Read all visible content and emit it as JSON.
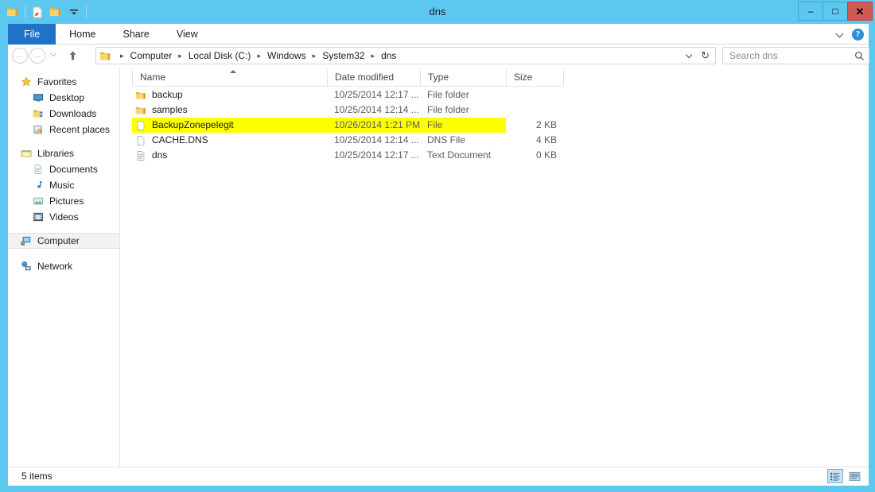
{
  "window": {
    "title": "dns",
    "controls": {
      "minimize": "–",
      "maximize": "□",
      "close": "✕"
    },
    "colors": {
      "frame": "#5cc8ef",
      "file_tab": "#1e72c8",
      "close_button": "#cf5a51",
      "highlight": "#ffff00",
      "selection": "#f2f2f2"
    }
  },
  "quick_access": [
    {
      "name": "folder-icon",
      "label": "Folder"
    },
    {
      "name": "properties-icon",
      "label": "Properties"
    },
    {
      "name": "new-folder-icon",
      "label": "New folder"
    },
    {
      "name": "customize-dropdown-icon",
      "label": "Customize Quick Access Toolbar"
    }
  ],
  "ribbon": {
    "tabs": [
      {
        "label": "File",
        "active": true
      },
      {
        "label": "Home",
        "active": false
      },
      {
        "label": "Share",
        "active": false
      },
      {
        "label": "View",
        "active": false
      }
    ],
    "expand_icon": "chevron-down-icon",
    "help_label": "?"
  },
  "address_bar": {
    "back_glyph": "←",
    "forward_glyph": "→",
    "recent_icon": "chevron-down-icon",
    "up_glyph": "↑",
    "breadcrumbs": [
      "Computer",
      "Local Disk (C:)",
      "Windows",
      "System32",
      "dns"
    ],
    "separator": "▸",
    "refresh_glyph": "↻"
  },
  "search": {
    "placeholder": "Search dns",
    "value": "",
    "icon": "search-icon"
  },
  "sidebar": {
    "groups": [
      {
        "name": "favorites",
        "root": {
          "label": "Favorites",
          "icon": "star-icon"
        },
        "children": [
          {
            "label": "Desktop",
            "icon": "desktop-icon"
          },
          {
            "label": "Downloads",
            "icon": "downloads-icon"
          },
          {
            "label": "Recent places",
            "icon": "recent-places-icon"
          }
        ]
      },
      {
        "name": "libraries",
        "root": {
          "label": "Libraries",
          "icon": "libraries-icon"
        },
        "children": [
          {
            "label": "Documents",
            "icon": "document-icon"
          },
          {
            "label": "Music",
            "icon": "music-note-icon"
          },
          {
            "label": "Pictures",
            "icon": "picture-icon"
          },
          {
            "label": "Videos",
            "icon": "video-icon"
          }
        ]
      },
      {
        "name": "computer",
        "root": {
          "label": "Computer",
          "icon": "computer-icon",
          "selected": true
        },
        "children": []
      },
      {
        "name": "network",
        "root": {
          "label": "Network",
          "icon": "network-icon"
        },
        "children": []
      }
    ]
  },
  "file_list": {
    "columns": [
      {
        "key": "name",
        "label": "Name",
        "sorted": "asc"
      },
      {
        "key": "date",
        "label": "Date modified"
      },
      {
        "key": "type",
        "label": "Type"
      },
      {
        "key": "size",
        "label": "Size"
      }
    ],
    "rows": [
      {
        "name": "backup",
        "date": "10/25/2014 12:17 ...",
        "type": "File folder",
        "size": "",
        "icon": "folder-icon",
        "marked": false
      },
      {
        "name": "samples",
        "date": "10/25/2014 12:14 ...",
        "type": "File folder",
        "size": "",
        "icon": "folder-icon",
        "marked": false
      },
      {
        "name": "BackupZonepelegit",
        "date": "10/26/2014 1:21 PM",
        "type": "File",
        "size": "2 KB",
        "icon": "blank-file-icon",
        "marked": true
      },
      {
        "name": "CACHE.DNS",
        "date": "10/25/2014 12:14 ...",
        "type": "DNS File",
        "size": "4 KB",
        "icon": "blank-file-icon",
        "marked": false
      },
      {
        "name": "dns",
        "date": "10/25/2014 12:17 ...",
        "type": "Text Document",
        "size": "0 KB",
        "icon": "text-document-icon",
        "marked": false
      }
    ]
  },
  "status_bar": {
    "item_count": "5 items",
    "views": [
      {
        "name": "details-view-button",
        "active": true
      },
      {
        "name": "large-icons-view-button",
        "active": false
      }
    ]
  }
}
